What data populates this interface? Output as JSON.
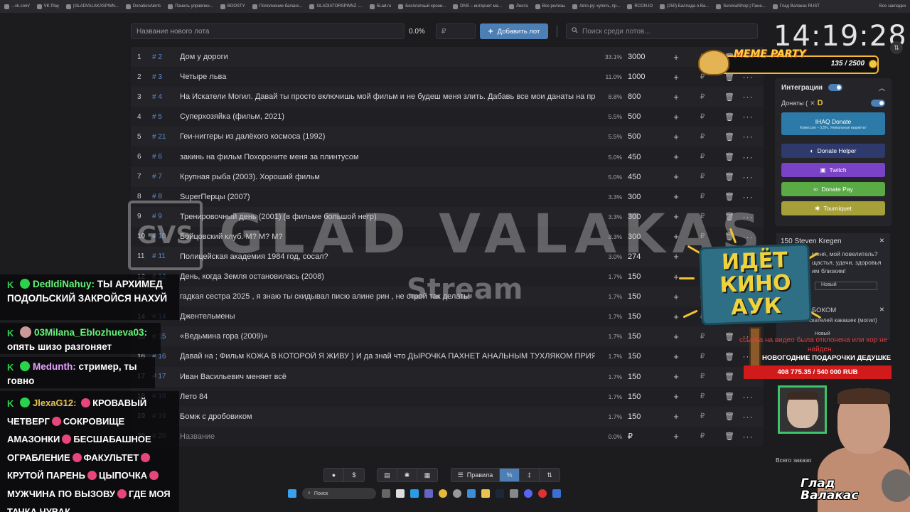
{
  "bookmarks": [
    "...vk.com/",
    "VK Play",
    "|GLADVALAKASPWN...",
    "DonationAlerts",
    "Панель управлен...",
    "BOOSTY",
    "Пополнение баланс...",
    "GLADIATORSPWNZ -...",
    "5Lad.ru",
    "Бесплатный хрони...",
    "DNS – интернет ма...",
    "Лента",
    "Все релизы",
    "Авто.ру: купить, пр...",
    "RCON.IO",
    "(250) Баллада о Ва...",
    "SurvivalShop | Пане...",
    "Глад Валакас RUST"
  ],
  "bookmarks_all": "Все закладки",
  "toolbar": {
    "lot_placeholder": "Название нового лота",
    "percent": "0.0%",
    "currency": "₽",
    "add_label": "Добавить лот",
    "search_placeholder": "Поиск среди лотов..."
  },
  "lots": [
    {
      "num": "1",
      "id": "# 2",
      "name": "Дом у дороги",
      "pct": "33.1%",
      "amount": "3000"
    },
    {
      "num": "2",
      "id": "# 3",
      "name": "Четыре льва",
      "pct": "11.0%",
      "amount": "1000"
    },
    {
      "num": "3",
      "id": "# 4",
      "name": "На Искатели Могил. Давай ты просто включишь мой фильм и не будеш меня злить. Дабавь все мои данаты на пр",
      "pct": "8.8%",
      "amount": "800"
    },
    {
      "num": "4",
      "id": "# 5",
      "name": "Суперхозяйка (фильм, 2021)",
      "pct": "5.5%",
      "amount": "500"
    },
    {
      "num": "5",
      "id": "# 21",
      "name": "Геи-ниггеры из далёкого космоса (1992)",
      "pct": "5.5%",
      "amount": "500"
    },
    {
      "num": "6",
      "id": "# 6",
      "name": "закинь на фильм Похороните меня за плинтусом",
      "pct": "5.0%",
      "amount": "450"
    },
    {
      "num": "7",
      "id": "# 7",
      "name": "Крупная рыба (2003). Хороший фильм",
      "pct": "5.0%",
      "amount": "450"
    },
    {
      "num": "8",
      "id": "# 8",
      "name": "SuperПерцы (2007)",
      "pct": "3.3%",
      "amount": "300"
    },
    {
      "num": "9",
      "id": "# 9",
      "name": "Тренировочный день (2001) (в фильме большой негр)",
      "pct": "3.3%",
      "amount": "300"
    },
    {
      "num": "10",
      "id": "# 10",
      "name": "Бойцовский клуб. М? М? М?",
      "pct": "3.3%",
      "amount": "300"
    },
    {
      "num": "11",
      "id": "# 11",
      "name": "Полицейская академия 1984 год, сосал?",
      "pct": "3.0%",
      "amount": "274"
    },
    {
      "num": "12",
      "id": "# 12",
      "name": "День, когда Земля остановилась (2008)",
      "pct": "1.7%",
      "amount": "150"
    },
    {
      "num": "13",
      "id": "# 13",
      "name": "гадкая сестра 2025 , я знаю ты скидывал писю алине рин , не строй так делать!",
      "pct": "1.7%",
      "amount": "150"
    },
    {
      "num": "14",
      "id": "# 14",
      "name": "Джентельмены",
      "pct": "1.7%",
      "amount": "150"
    },
    {
      "num": "15",
      "id": "# 15",
      "name": "«Ведьмина гора (2009)»",
      "pct": "1.7%",
      "amount": "150"
    },
    {
      "num": "16",
      "id": "# 16",
      "name": "Давай на ; Фильм КОЖА В КОТОРОЙ Я ЖИВУ ) И да знай что ДЫРОЧКА ПАХНЕТ АНАЛЬНЫМ ТУХЛЯКОМ ПРИЯТН",
      "pct": "1.7%",
      "amount": "150"
    },
    {
      "num": "17",
      "id": "# 17",
      "name": "Иван Васильевич меняет всё",
      "pct": "1.7%",
      "amount": "150"
    },
    {
      "num": "18",
      "id": "# 18",
      "name": "Лето 84",
      "pct": "1.7%",
      "amount": "150"
    },
    {
      "num": "19",
      "id": "# 19",
      "name": "Бомж с дробовиком",
      "pct": "1.7%",
      "amount": "150"
    },
    {
      "num": "20",
      "id": "# 20",
      "name": "Название",
      "pct": "0.0%",
      "amount": "₽"
    }
  ],
  "row_currency": "₽",
  "watermark": {
    "logo": "GVS",
    "title": "GLAD VALAKAS",
    "subtitle": "Stream"
  },
  "clock": "14:19:28",
  "meme_party": {
    "title": "MEME PARTY",
    "progress": "135 / 2500"
  },
  "integrations": {
    "title": "Интеграции",
    "donaty_label": "Донаты (",
    "ihaq_title": "IHAQ Donate",
    "ihaq_sub": "Комиссия – 3,5%. Уникальные виджеты!",
    "helper": "Donate Helper",
    "twitch": "Twitch",
    "donatepay": "Donate Pay",
    "tourniquet": "Tourniquet"
  },
  "notifications": {
    "name": "150 Steven Kregen",
    "line1": "меня, мой повелитель?",
    "line2": "щастья, удачи, здоровья",
    "line3": "им близким!",
    "status1": "Новый",
    "sub_title": "БОКОМ",
    "sub_line": "скателей какашек (могил)",
    "status2": "Новый"
  },
  "sign_lines": [
    "ИДЁТ",
    "КИНО",
    "АУК"
  ],
  "red_text_1": "ссылка на видео была отклонена или хор не",
  "red_text_2": "найден.",
  "gift_title": "НОВОГОДНИЕ ПОДАРОЧКИ ДЕДУШКЕ",
  "goal": "408 775.35 / 540 000 RUB",
  "total_label": "Всего заказо",
  "streamer_name": [
    "Глад",
    "Валакас"
  ],
  "chat": [
    {
      "user": "DedIdiNahuy:",
      "text": "ТЫ АРХИМЕД ПОДОЛЬСКИЙ ЗАКРОЙСЯ НАХУЙ"
    },
    {
      "user": "03Milana_Eblozhueva03:",
      "text": "опять шизо разгоняет"
    },
    {
      "user": "Medunth:",
      "text": "стример, ты говно"
    },
    {
      "user": "JlexaG12:",
      "text_parts": [
        "КРОВАВЫЙ ЧЕТВЕРГ",
        "СОКРОВИЩЕ АМАЗОНКИ",
        "БЕСШАБАШНОЕ ОГРАБЛЕНИЕ",
        "ФАКУЛЬТЕТ",
        "КРУТОЙ ПАРЕНЬ",
        "ЦЫПОЧКА",
        "МУЖЧИНА ПО ВЫЗОВУ",
        "ГДЕ МОЯ ТАЧКА ЧУВАК"
      ]
    }
  ],
  "bottom_toolbar": {
    "rules": "Правила",
    "dollar": "$",
    "percent": "%",
    "plus_minus": "‡",
    "sort": "⇅"
  },
  "taskbar": {
    "search": "Поиск"
  }
}
